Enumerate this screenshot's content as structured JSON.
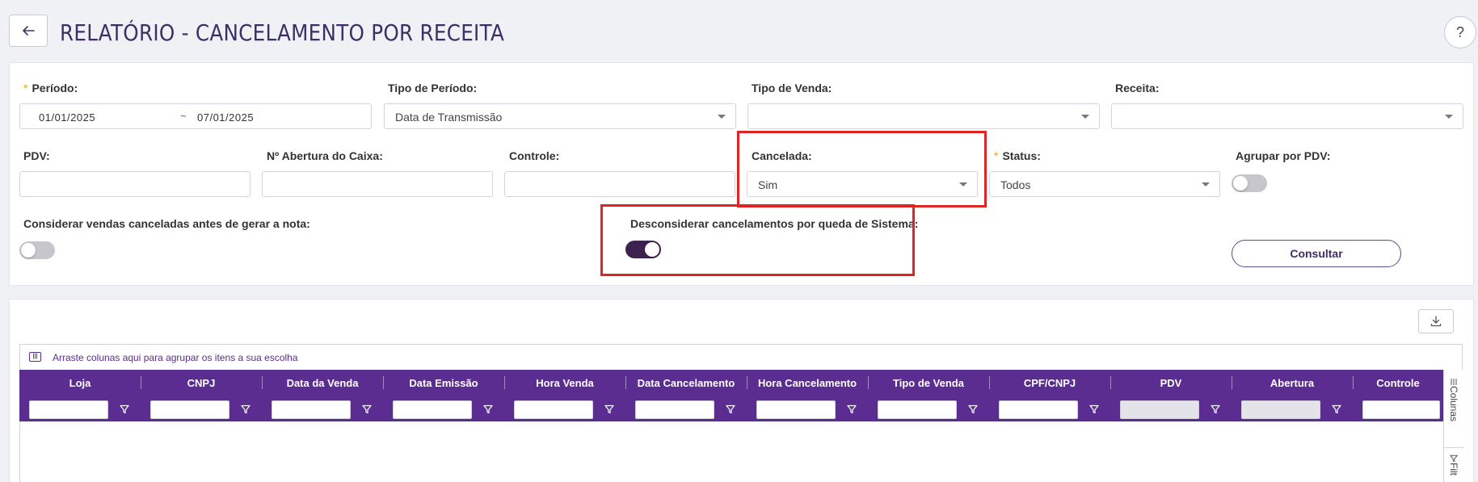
{
  "header": {
    "title": "RELATÓRIO - CANCELAMENTO POR RECEITA",
    "help_label": "?"
  },
  "filters": {
    "periodo": {
      "label": "Período",
      "start": "01/01/2025",
      "separator": "~",
      "end": "07/01/2025"
    },
    "tipo_periodo": {
      "label": "Tipo de Período",
      "value": "Data de Transmissão"
    },
    "tipo_venda": {
      "label": "Tipo de Venda",
      "value": ""
    },
    "receita": {
      "label": "Receita",
      "value": ""
    },
    "pdv": {
      "label": "PDV",
      "value": ""
    },
    "abertura_caixa": {
      "label": "Nº Abertura do Caixa",
      "value": ""
    },
    "controle": {
      "label": "Controle",
      "value": ""
    },
    "cancelada": {
      "label": "Cancelada",
      "value": "Sim"
    },
    "status": {
      "label": "Status",
      "value": "Todos"
    },
    "agrupar_pdv": {
      "label": "Agrupar por PDV",
      "on": false
    },
    "considerar_canceladas": {
      "label": "Considerar vendas canceladas antes de gerar a nota",
      "on": false
    },
    "desconsiderar_queda": {
      "label": "Desconsiderar cancelamentos por queda de Sistema",
      "on": true
    },
    "colon": ":",
    "required_mark": "*"
  },
  "actions": {
    "consultar_label": "Consultar"
  },
  "grid": {
    "group_panel_text": "Arraste colunas aqui para agrupar os itens a sua escolha",
    "group_icon_text": "|||",
    "columns": [
      "Loja",
      "CNPJ",
      "Data da Venda",
      "Data Emissão",
      "Hora Venda",
      "Data Cancelamento",
      "Hora Cancelamento",
      "Tipo de Venda",
      "CPF/CNPJ",
      "PDV",
      "Abertura",
      "Controle"
    ],
    "side_tabs": [
      "Colunas",
      "Filt"
    ]
  },
  "colors": {
    "accent": "#5c2d91",
    "title": "#3d2f66",
    "highlight": "#e02424",
    "toggle_on": "#3d2250",
    "required": "#e8a020"
  }
}
